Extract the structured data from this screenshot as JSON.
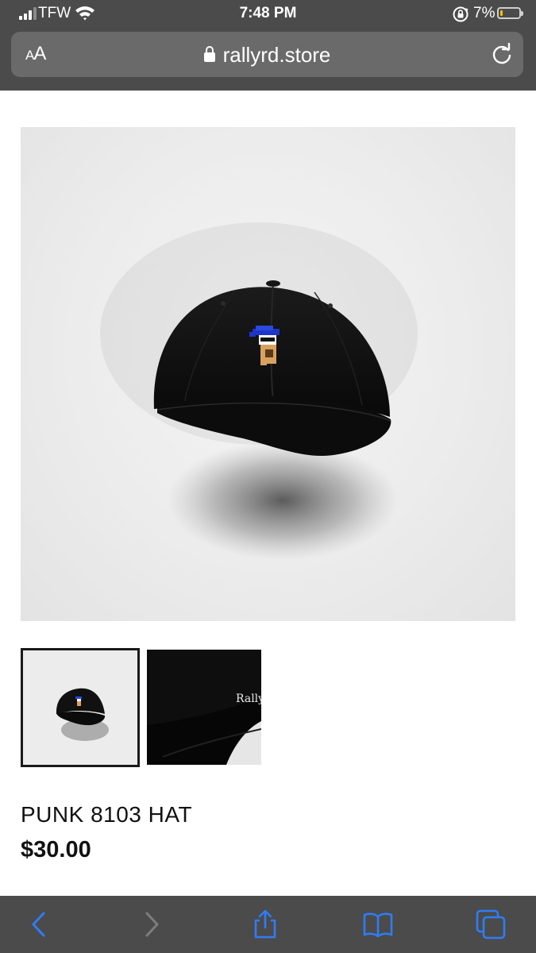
{
  "status_bar": {
    "carrier": "TFW",
    "time": "7:48 PM",
    "battery_percent": "7%",
    "battery_level": 0.07,
    "battery_color": "#f2c200"
  },
  "address_bar": {
    "text_size_label": "AA",
    "url": "rallyrd.store",
    "lock_icon": "lock-icon",
    "reload_icon": "reload-icon"
  },
  "product": {
    "title": "PUNK 8103 HAT",
    "price": "$30.00",
    "thumbnails": [
      {
        "name": "front view",
        "selected": true
      },
      {
        "name": "side detail",
        "selected": false,
        "embroidery_text": "Rallyı"
      }
    ]
  },
  "toolbar": {
    "items": [
      "back-icon",
      "forward-icon",
      "share-icon",
      "bookmarks-icon",
      "tabs-icon"
    ],
    "accent": "#2f7cf6"
  }
}
